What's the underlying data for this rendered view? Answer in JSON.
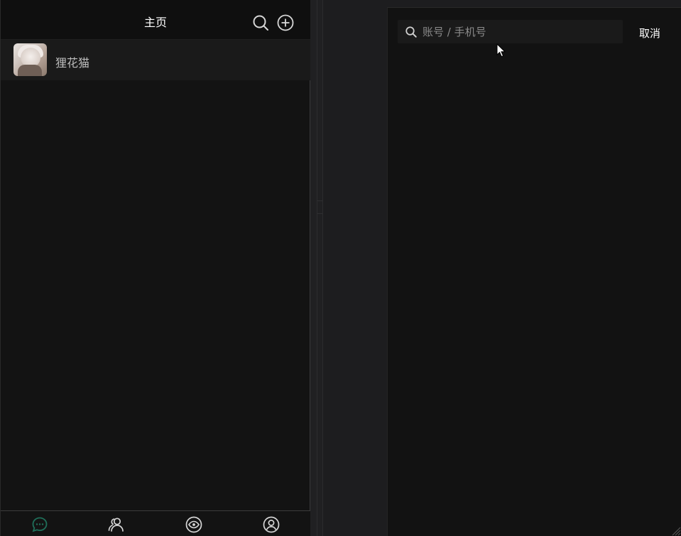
{
  "left_window": {
    "header": {
      "title": "主页",
      "icons": [
        "search-icon",
        "add-circle-icon"
      ]
    },
    "contacts": [
      {
        "name": "狸花猫",
        "avatar": "avatar-image"
      }
    ],
    "tabbar": {
      "tabs": [
        {
          "icon": "chat-bubble-icon",
          "active": true
        },
        {
          "icon": "contacts-icon",
          "active": false
        },
        {
          "icon": "eye-icon",
          "active": false
        },
        {
          "icon": "user-profile-icon",
          "active": false
        }
      ],
      "active_color": "#1f6f5a"
    }
  },
  "right_window": {
    "search": {
      "placeholder": "账号 / 手机号",
      "value": ""
    },
    "cancel_label": "取消"
  },
  "colors": {
    "background": "#131313",
    "header": "#0f0f0f",
    "row": "#1a1a1a",
    "text_primary": "#ffffff",
    "text_secondary": "#bdbdbd"
  }
}
